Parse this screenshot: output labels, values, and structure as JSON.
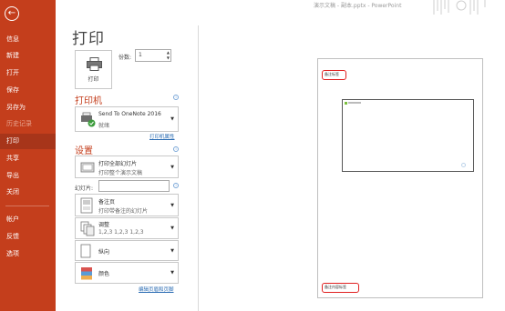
{
  "window": {
    "title": "演示文稿 - 副本.pptx - PowerPoint"
  },
  "sidebar": {
    "back_icon": "arrow-left-icon",
    "items": [
      {
        "label": "信息"
      },
      {
        "label": "新建"
      },
      {
        "label": "打开"
      },
      {
        "label": "保存"
      },
      {
        "label": "另存为"
      },
      {
        "label": "历史记录"
      },
      {
        "label": "打印"
      },
      {
        "label": "共享"
      },
      {
        "label": "导出"
      },
      {
        "label": "关闭"
      },
      {
        "label": "帐户"
      },
      {
        "label": "反馈"
      },
      {
        "label": "选项"
      }
    ],
    "active": "打印"
  },
  "main": {
    "title": "打印",
    "print_button": "打印",
    "copies_label": "份数:",
    "copies_value": "1",
    "printer_section": "打印机",
    "printer_name": "Send To OneNote 2016",
    "printer_status": "就绪",
    "printer_props_link": "打印机属性",
    "settings_section": "设置",
    "setting_slides_title": "打印全部幻灯片",
    "setting_slides_sub": "打印整个演示文稿",
    "slides_label": "幻灯片:",
    "slides_input_value": "",
    "setting_layout_title": "备注页",
    "setting_layout_sub": "打印带备注的幻灯片",
    "setting_collate_title": "调整",
    "setting_collate_sub": "1,2,3    1,2,3    1,2,3",
    "setting_orientation": "纵向",
    "setting_color": "颜色",
    "edit_header_footer_link": "编辑页眉和页脚"
  },
  "preview": {
    "header_label": "备注标签",
    "footer_label": "备注内容标签"
  },
  "colors": {
    "accent": "#c43e1c",
    "active_nav": "#a7351a",
    "link": "#2b6cb3",
    "highlight": "#e02020"
  }
}
